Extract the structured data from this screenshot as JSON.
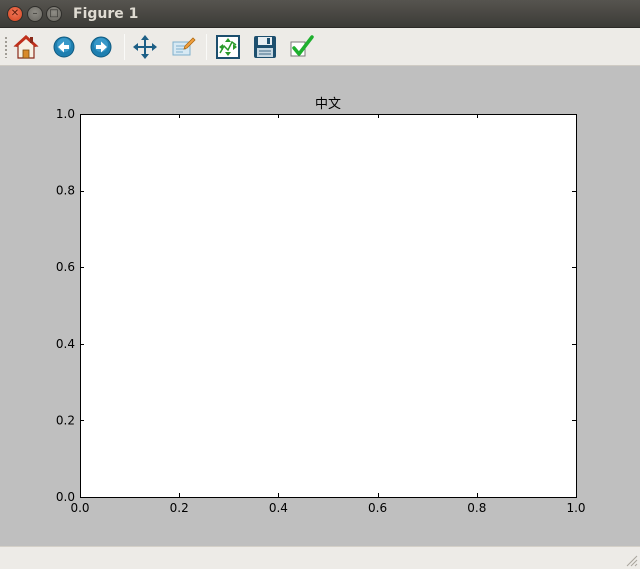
{
  "window": {
    "title": "Figure 1"
  },
  "toolbar": {
    "buttons": [
      {
        "icon": "home-icon"
      },
      {
        "icon": "back-icon"
      },
      {
        "icon": "forward-icon"
      },
      {
        "icon": "pan-icon"
      },
      {
        "icon": "zoom-icon"
      },
      {
        "icon": "subplots-icon"
      },
      {
        "icon": "save-icon"
      },
      {
        "icon": "edit-check-icon"
      }
    ]
  },
  "chart_data": {
    "type": "line",
    "title": "中文",
    "xlabel": "",
    "ylabel": "",
    "xlim": [
      0.0,
      1.0
    ],
    "ylim": [
      0.0,
      1.0
    ],
    "xticks": [
      "0.0",
      "0.2",
      "0.4",
      "0.6",
      "0.8",
      "1.0"
    ],
    "yticks": [
      "0.0",
      "0.2",
      "0.4",
      "0.6",
      "0.8",
      "1.0"
    ],
    "series": [],
    "grid": false
  },
  "colors": {
    "figure_background": "#bfbfbf",
    "axes_background": "#ffffff"
  }
}
